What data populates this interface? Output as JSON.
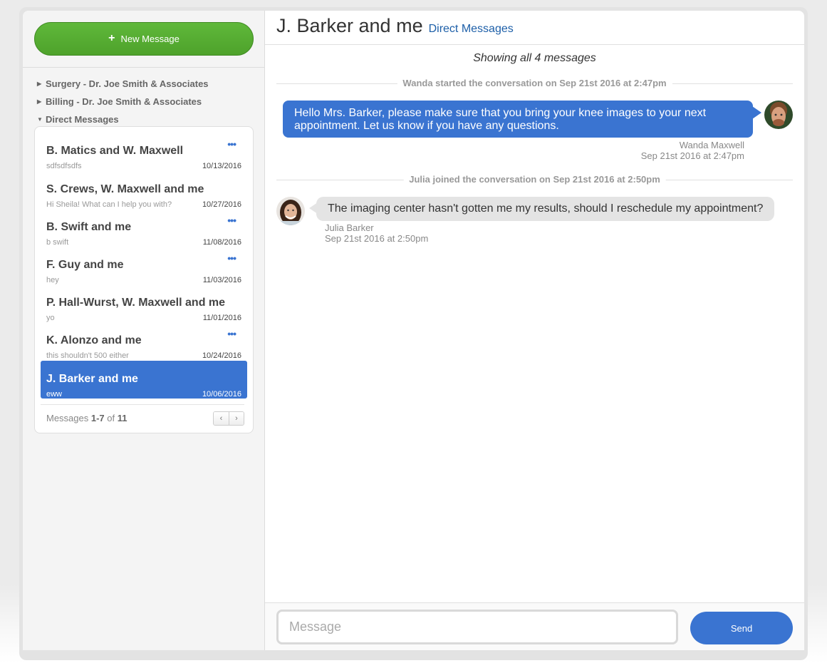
{
  "sidebar": {
    "new_message_label": "New Message",
    "folders": [
      {
        "label": "Surgery - Dr. Joe Smith & Associates",
        "expanded": false
      },
      {
        "label": "Billing - Dr. Joe Smith & Associates",
        "expanded": false
      },
      {
        "label": "Direct Messages",
        "expanded": true
      }
    ],
    "conversations": [
      {
        "name": "B. Matics and W. Maxwell",
        "preview": "sdfsdfsdfs",
        "date": "10/13/2016",
        "more": "•••"
      },
      {
        "name": "S. Crews, W. Maxwell and me",
        "preview": "Hi Sheila! What can I help you with?",
        "date": "10/27/2016",
        "more": ""
      },
      {
        "name": "B. Swift and me",
        "preview": "b swift",
        "date": "11/08/2016",
        "more": "•••"
      },
      {
        "name": "F. Guy and me",
        "preview": "hey",
        "date": "11/03/2016",
        "more": "•••"
      },
      {
        "name": "P. Hall-Wurst, W. Maxwell and me",
        "preview": "yo",
        "date": "11/01/2016",
        "more": ""
      },
      {
        "name": "K. Alonzo and me",
        "preview": "this shouldn't 500 either",
        "date": "10/24/2016",
        "more": "•••"
      },
      {
        "name": "J. Barker and me",
        "preview": "eww",
        "date": "10/06/2016",
        "more": "",
        "selected": true
      }
    ],
    "pager": {
      "prefix": "Messages ",
      "range": "1-7",
      "of": " of ",
      "total": "11",
      "prev": "‹",
      "next": "›"
    }
  },
  "header": {
    "title": "J. Barker and me",
    "folder_link": "Direct Messages"
  },
  "thread": {
    "showing": "Showing all 4 messages",
    "system_1": "Wanda started the conversation on Sep 21st 2016 at 2:47pm",
    "msg_out": {
      "text": "Hello Mrs. Barker, please make sure that you bring your knee images to your next appointment. Let us know if you have any questions.",
      "author": "Wanda Maxwell",
      "time": "Sep 21st 2016 at 2:47pm"
    },
    "system_2": "Julia joined the conversation on Sep 21st 2016 at 2:50pm",
    "msg_in": {
      "text": "The imaging center hasn't gotten me my results, should I reschedule my appointment?",
      "author": "Julia Barker",
      "time": "Sep 21st 2016 at 2:50pm"
    }
  },
  "composer": {
    "placeholder": "Message",
    "value": "",
    "send_label": "Send"
  },
  "colors": {
    "primary_blue": "#3a74d1",
    "green": "#4ea22b",
    "link": "#1d5fa8"
  }
}
